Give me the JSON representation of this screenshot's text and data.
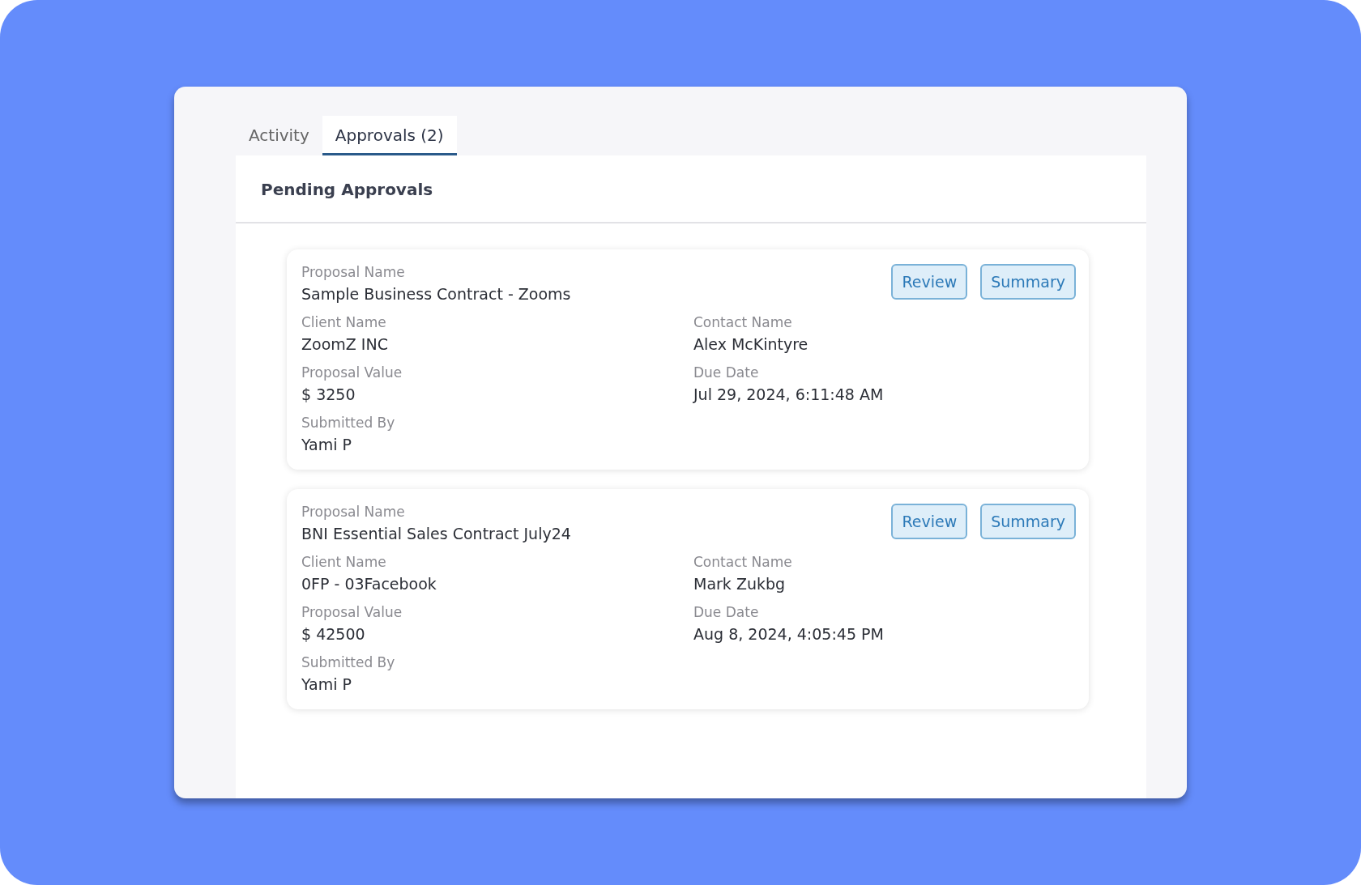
{
  "tabs": [
    {
      "label": "Activity",
      "selected": false
    },
    {
      "label": "Approvals (2)",
      "selected": true
    }
  ],
  "section_title": "Pending Approvals",
  "approvals": [
    {
      "proposal": {
        "label": "Proposal Name",
        "value": "Sample Business Contract - Zooms"
      },
      "buttons": [
        "Review",
        "Summary"
      ],
      "left_fields": [
        {
          "label": "Client Name",
          "value": "ZoomZ INC"
        },
        {
          "label": "Proposal Value",
          "value": "$ 3250"
        },
        {
          "label": "Submitted By",
          "value": "Yami P"
        }
      ],
      "right_fields": [
        {
          "label": "Contact Name",
          "value": "Alex McKintyre"
        },
        {
          "label": "Due Date",
          "value": "Jul 29, 2024, 6:11:48 AM"
        }
      ]
    },
    {
      "proposal": {
        "label": "Proposal Name",
        "value": "BNI Essential Sales Contract July24"
      },
      "buttons": [
        "Review",
        "Summary"
      ],
      "left_fields": [
        {
          "label": "Client Name",
          "value": "0FP - 03Facebook"
        },
        {
          "label": "Proposal Value",
          "value": "$ 42500"
        },
        {
          "label": "Submitted By",
          "value": "Yami P"
        }
      ],
      "right_fields": [
        {
          "label": "Contact Name",
          "value": "Mark Zukbg"
        },
        {
          "label": "Due Date",
          "value": "Aug 8, 2024, 4:05:45 PM"
        }
      ]
    }
  ]
}
